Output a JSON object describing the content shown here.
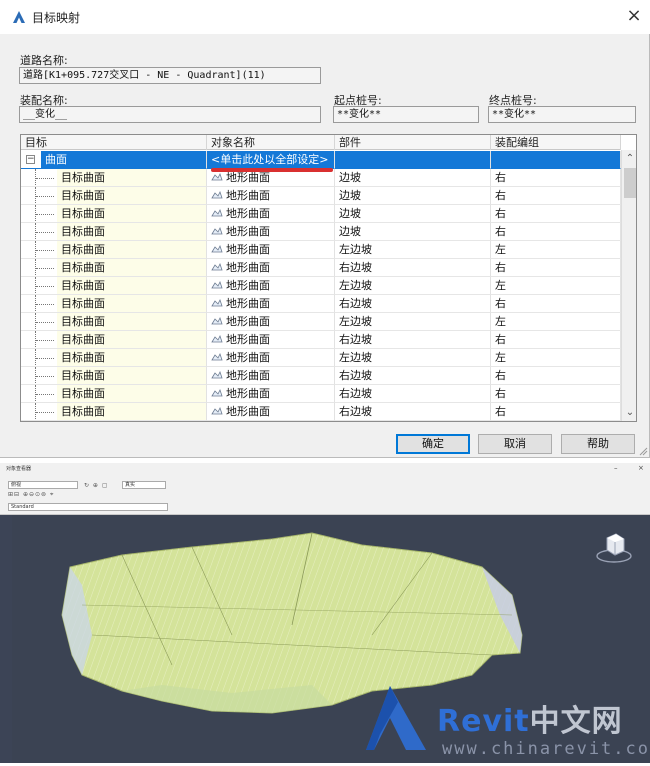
{
  "dialog": {
    "title": "目标映射",
    "close": "×",
    "road_name_label": "道路名称:",
    "road_name_value": "道路[K1+095.727交叉口 - NE - Quadrant](11)",
    "assembly_name_label": "装配名称:",
    "assembly_name_value": "__变化__",
    "start_station_label": "起点桩号:",
    "start_station_value": "**变化**",
    "end_station_label": "终点桩号:",
    "end_station_value": "**变化**",
    "columns": [
      "目标",
      "对象名称",
      "部件",
      "装配编组"
    ],
    "group_row": {
      "expander": "−",
      "target": "曲面",
      "object": "<单击此处以全部设定>",
      "part": "",
      "group": ""
    },
    "rows": [
      {
        "target": "目标曲面",
        "object": "地形曲面",
        "part": "边坡",
        "group": "右"
      },
      {
        "target": "目标曲面",
        "object": "地形曲面",
        "part": "边坡",
        "group": "右"
      },
      {
        "target": "目标曲面",
        "object": "地形曲面",
        "part": "边坡",
        "group": "右"
      },
      {
        "target": "目标曲面",
        "object": "地形曲面",
        "part": "边坡",
        "group": "右"
      },
      {
        "target": "目标曲面",
        "object": "地形曲面",
        "part": "左边坡",
        "group": "左"
      },
      {
        "target": "目标曲面",
        "object": "地形曲面",
        "part": "右边坡",
        "group": "右"
      },
      {
        "target": "目标曲面",
        "object": "地形曲面",
        "part": "左边坡",
        "group": "左"
      },
      {
        "target": "目标曲面",
        "object": "地形曲面",
        "part": "右边坡",
        "group": "右"
      },
      {
        "target": "目标曲面",
        "object": "地形曲面",
        "part": "左边坡",
        "group": "左"
      },
      {
        "target": "目标曲面",
        "object": "地形曲面",
        "part": "右边坡",
        "group": "右"
      },
      {
        "target": "目标曲面",
        "object": "地形曲面",
        "part": "左边坡",
        "group": "左"
      },
      {
        "target": "目标曲面",
        "object": "地形曲面",
        "part": "右边坡",
        "group": "右"
      },
      {
        "target": "目标曲面",
        "object": "地形曲面",
        "part": "右边坡",
        "group": "右"
      },
      {
        "target": "目标曲面",
        "object": "地形曲面",
        "part": "右边坡",
        "group": "右"
      }
    ],
    "buttons": {
      "ok": "确定",
      "cancel": "取消",
      "help": "帮助"
    }
  },
  "cad": {
    "window_title": "对象查看器",
    "view_select": "俯视",
    "style_select": "Standard",
    "shade_select": "真实"
  },
  "watermark": {
    "brand": "Revit",
    "brand_cn": "中文网",
    "url": "www.chinarevit.com"
  },
  "colors": {
    "selection": "#1478d7",
    "tin_surface": "#d9e8a0",
    "viewport_bg": "#3b4353",
    "brand_blue": "#2f6fd6"
  }
}
